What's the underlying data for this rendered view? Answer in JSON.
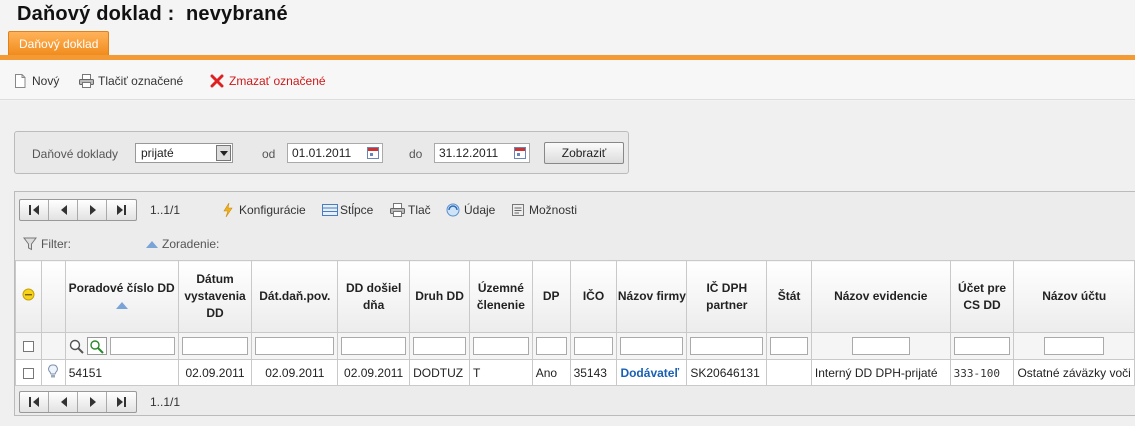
{
  "header": {
    "title": "Daňový doklad :  nevybrané",
    "tab_label": "Daňový doklad"
  },
  "toolbar": {
    "new_label": "Nový",
    "print_label": "Tlačiť označené",
    "delete_label": "Zmazať označené"
  },
  "filter": {
    "doc_label": "Daňové doklady",
    "doc_type_value": "prijaté",
    "from_label": "od",
    "from_date": "01.01.2011",
    "to_label": "do",
    "to_date": "31.12.2011",
    "show_button": "Zobraziť"
  },
  "grid": {
    "page_info": "1..1/1",
    "tools": {
      "config": "Konfigurácie",
      "columns": "Stĺpce",
      "print": "Tlač",
      "data": "Údaje",
      "options": "Možnosti"
    },
    "filter_label": "Filter:",
    "sort_label": "Zoradenie:",
    "columns": {
      "poradove": "Poradové číslo DD",
      "datum_vystavenia": "Dátum vystavenia DD",
      "dat_dan_pov": "Dát.daň.pov.",
      "dd_dosiel": "DD došiel dňa",
      "druh": "Druh DD",
      "uzemne": "Územné členenie",
      "dp": "DP",
      "ico": "IČO",
      "nazov_firmy": "Názov firmy",
      "ic_dph": "IČ DPH partner",
      "stat": "Štát",
      "nazov_evidencie": "Názov evidencie",
      "ucet_cs": "Účet pre CS DD",
      "nazov_uctu": "Názov účtu"
    },
    "rows": [
      {
        "poradove": "54151",
        "datum_vystavenia": "02.09.2011",
        "dat_dan_pov": "02.09.2011",
        "dd_dosiel": "02.09.2011",
        "druh": "DODTUZ",
        "uzemne": "T",
        "dp": "Ano",
        "ico": "35143",
        "nazov_firmy": "Dodávateľ",
        "ic_dph": "SK20646131",
        "stat": "",
        "nazov_evidencie": "Interný DD DPH-prijaté",
        "ucet_cs": "333-100",
        "nazov_uctu": "Ostatné záväzky voči"
      }
    ]
  },
  "colors": {
    "accent_orange": "#f39a35",
    "link_blue": "#1a5fb4",
    "delete_red": "#cc1a1a"
  }
}
